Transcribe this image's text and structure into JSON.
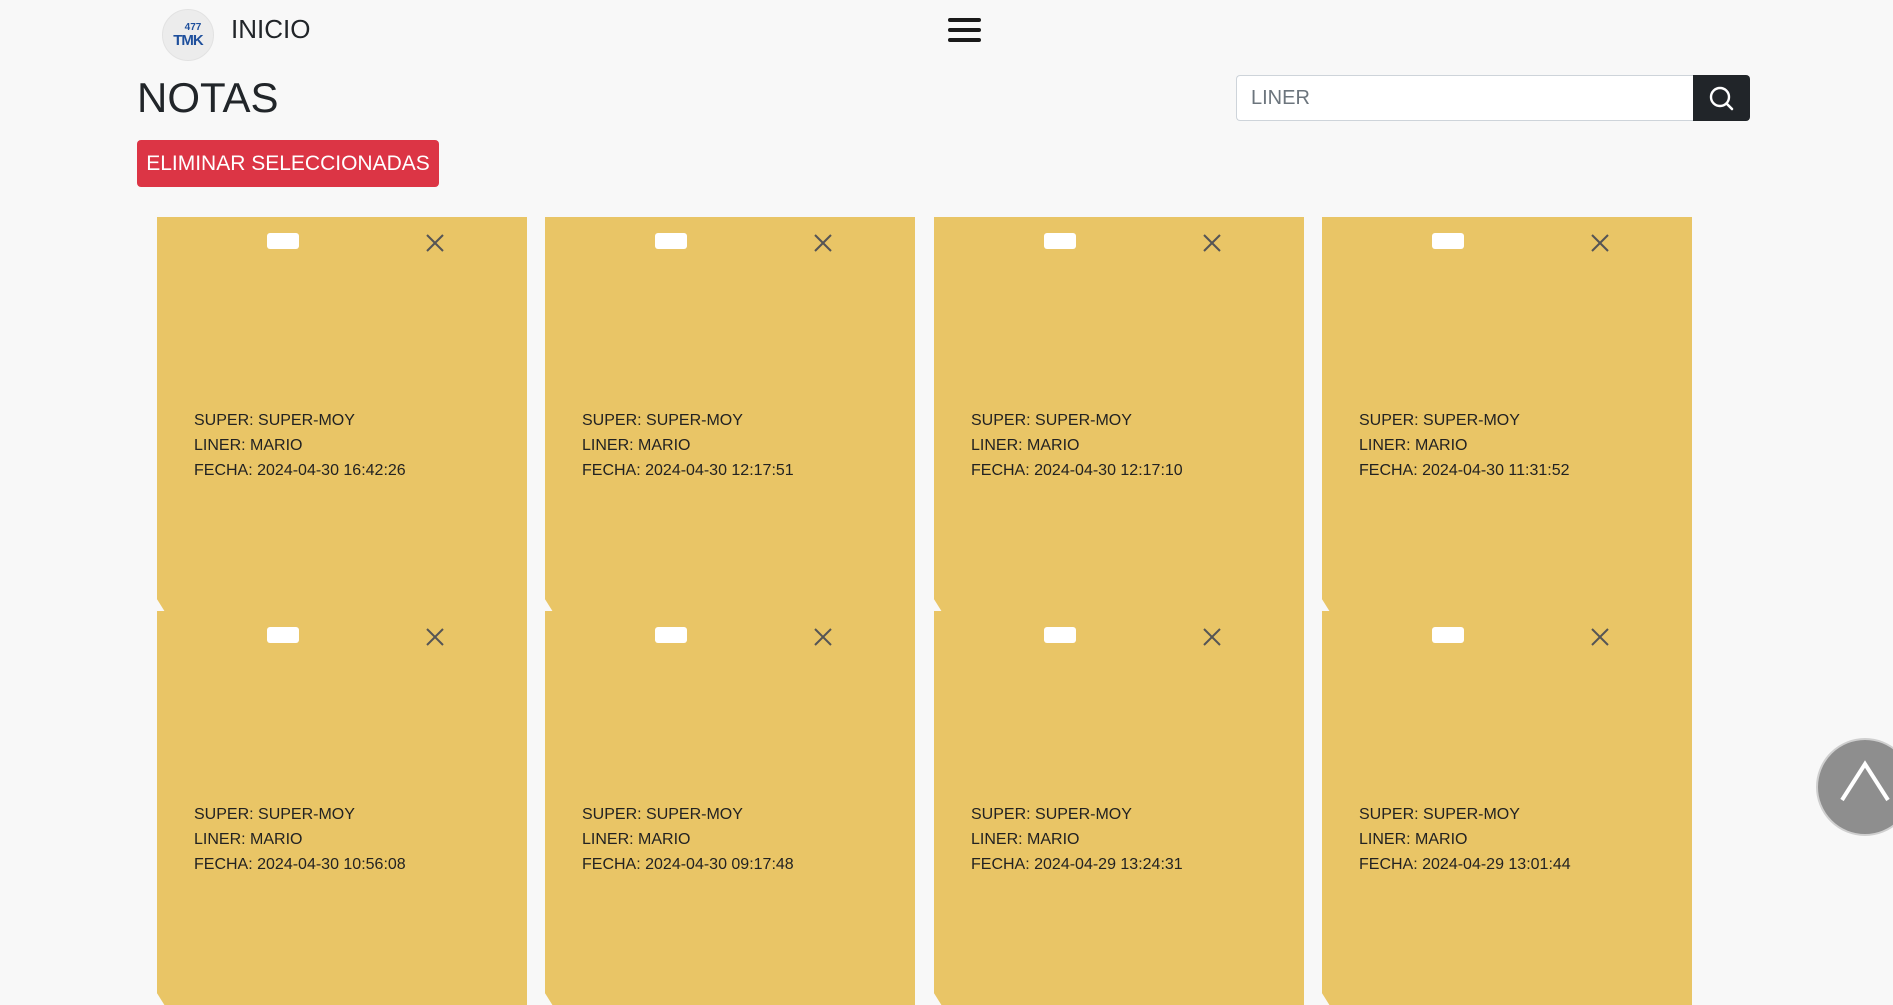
{
  "header": {
    "logo": {
      "number": "477",
      "letters": "TMK"
    },
    "brand": "INICIO",
    "menu_icon": "hamburger-icon"
  },
  "page": {
    "title": "NOTAS",
    "search": {
      "value": "",
      "placeholder": "LINER",
      "icon": "search-icon"
    },
    "delete_selected_label": "ELIMINAR SELECCIONADAS"
  },
  "notes": [
    {
      "super": "SUPER: SUPER-MOY",
      "liner": "LINER: MARIO",
      "fecha": "FECHA: 2024-04-30 16:42:26"
    },
    {
      "super": "SUPER: SUPER-MOY",
      "liner": "LINER: MARIO",
      "fecha": "FECHA: 2024-04-30 12:17:51"
    },
    {
      "super": "SUPER: SUPER-MOY",
      "liner": "LINER: MARIO",
      "fecha": "FECHA: 2024-04-30 12:17:10"
    },
    {
      "super": "SUPER: SUPER-MOY",
      "liner": "LINER: MARIO",
      "fecha": "FECHA: 2024-04-30 11:31:52"
    },
    {
      "super": "SUPER: SUPER-MOY",
      "liner": "LINER: MARIO",
      "fecha": "FECHA: 2024-04-30 10:56:08"
    },
    {
      "super": "SUPER: SUPER-MOY",
      "liner": "LINER: MARIO",
      "fecha": "FECHA: 2024-04-30 09:17:48"
    },
    {
      "super": "SUPER: SUPER-MOY",
      "liner": "LINER: MARIO",
      "fecha": "FECHA: 2024-04-29 13:24:31"
    },
    {
      "super": "SUPER: SUPER-MOY",
      "liner": "LINER: MARIO",
      "fecha": "FECHA: 2024-04-29 13:01:44"
    }
  ],
  "colors": {
    "note": "#e9c566",
    "danger": "#dc3545",
    "dark": "#212529",
    "scroll_top": "#8e8e8e"
  },
  "scroll_top_icon": "chevron-up-icon"
}
